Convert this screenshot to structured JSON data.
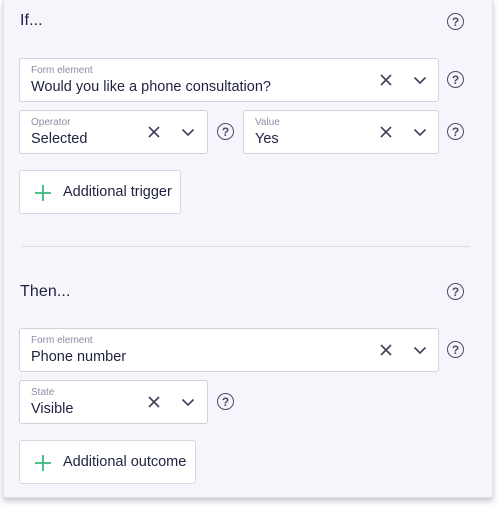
{
  "if_section": {
    "title": "If...",
    "form_element": {
      "label": "Form element",
      "value": "Would you like a phone consultation?"
    },
    "operator": {
      "label": "Operator",
      "value": "Selected"
    },
    "value_field": {
      "label": "Value",
      "value": "Yes"
    },
    "add_button": {
      "label": "Additional trigger"
    }
  },
  "then_section": {
    "title": "Then...",
    "form_element": {
      "label": "Form element",
      "value": "Phone number"
    },
    "state": {
      "label": "State",
      "value": "Visible"
    },
    "add_button": {
      "label": "Additional outcome"
    }
  },
  "help_glyph": "?",
  "icons": {
    "help": "question-circle-icon",
    "clear": "close-icon",
    "dropdown": "chevron-down-icon",
    "add": "plus-icon"
  },
  "colors": {
    "accent_plus": "#3bb77e",
    "text": "#1f2240",
    "muted": "#8a8ea6",
    "panel_bg": "#f5f5fb"
  }
}
